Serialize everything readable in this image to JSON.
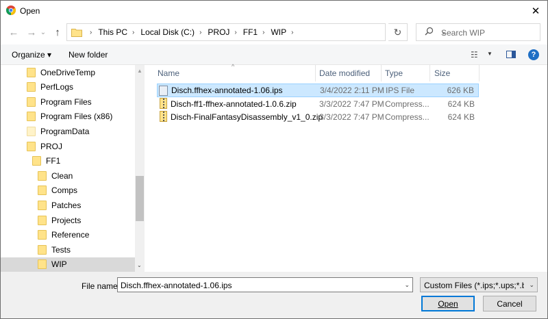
{
  "window": {
    "title": "Open",
    "close_glyph": "✕",
    "app_icon": "chrome-icon"
  },
  "nav": {
    "back_glyph": "←",
    "forward_glyph": "→",
    "recent_glyph": "⌄",
    "up_glyph": "↑"
  },
  "address": {
    "crumbs": [
      "This PC",
      "Local Disk (C:)",
      "PROJ",
      "FF1",
      "WIP"
    ],
    "separator": "›",
    "dropdown_glyph": "⌄",
    "refresh_glyph": "↻"
  },
  "search": {
    "placeholder": "Search WIP",
    "icon": "search-icon"
  },
  "toolbar": {
    "organize_label": "Organize ▾",
    "new_folder_label": "New folder",
    "view_glyph": "☷",
    "view_drop_glyph": "▼",
    "help_glyph": "?"
  },
  "sidebar": {
    "items": [
      {
        "label": "OneDriveTemp",
        "indent": 0,
        "light": false
      },
      {
        "label": "PerfLogs",
        "indent": 0,
        "light": false
      },
      {
        "label": "Program Files",
        "indent": 0,
        "light": false
      },
      {
        "label": "Program Files (x86)",
        "indent": 0,
        "light": false
      },
      {
        "label": "ProgramData",
        "indent": 0,
        "light": true
      },
      {
        "label": "PROJ",
        "indent": 0,
        "light": false
      },
      {
        "label": "FF1",
        "indent": 1,
        "light": false
      },
      {
        "label": "Clean",
        "indent": 2,
        "light": false
      },
      {
        "label": "Comps",
        "indent": 2,
        "light": false
      },
      {
        "label": "Patches",
        "indent": 2,
        "light": false
      },
      {
        "label": "Projects",
        "indent": 2,
        "light": false
      },
      {
        "label": "Reference",
        "indent": 2,
        "light": false
      },
      {
        "label": "Tests",
        "indent": 2,
        "light": false
      },
      {
        "label": "WIP",
        "indent": 2,
        "light": false
      }
    ],
    "selected": "WIP",
    "scroll_up_glyph": "▲",
    "scroll_down_glyph": "⌄"
  },
  "files": {
    "columns": {
      "name": "Name",
      "date": "Date modified",
      "type": "Type",
      "size": "Size"
    },
    "sort_glyph": "^",
    "rows": [
      {
        "name": "Disch.ffhex-annotated-1.06.ips",
        "date": "3/4/2022 2:11 PM",
        "type": "IPS File",
        "size": "626 KB",
        "icon": "ips-file-icon",
        "selected": true
      },
      {
        "name": "Disch-ff1-ffhex-annotated-1.0.6.zip",
        "date": "3/3/2022 7:47 PM",
        "type": "Compress...",
        "size": "624 KB",
        "icon": "zip-file-icon",
        "selected": false
      },
      {
        "name": "Disch-FinalFantasyDisassembly_v1_0.zip",
        "date": "3/3/2022 7:47 PM",
        "type": "Compress...",
        "size": "624 KB",
        "icon": "zip-file-icon",
        "selected": false
      }
    ]
  },
  "footer": {
    "filename_label": "File name:",
    "filename_value": "Disch.ffhex-annotated-1.06.ips",
    "filter_value": "Custom Files (*.ips;*.ups;*.bps;*",
    "dropdown_glyph": "⌄",
    "open_label": "Open",
    "cancel_label": "Cancel"
  }
}
